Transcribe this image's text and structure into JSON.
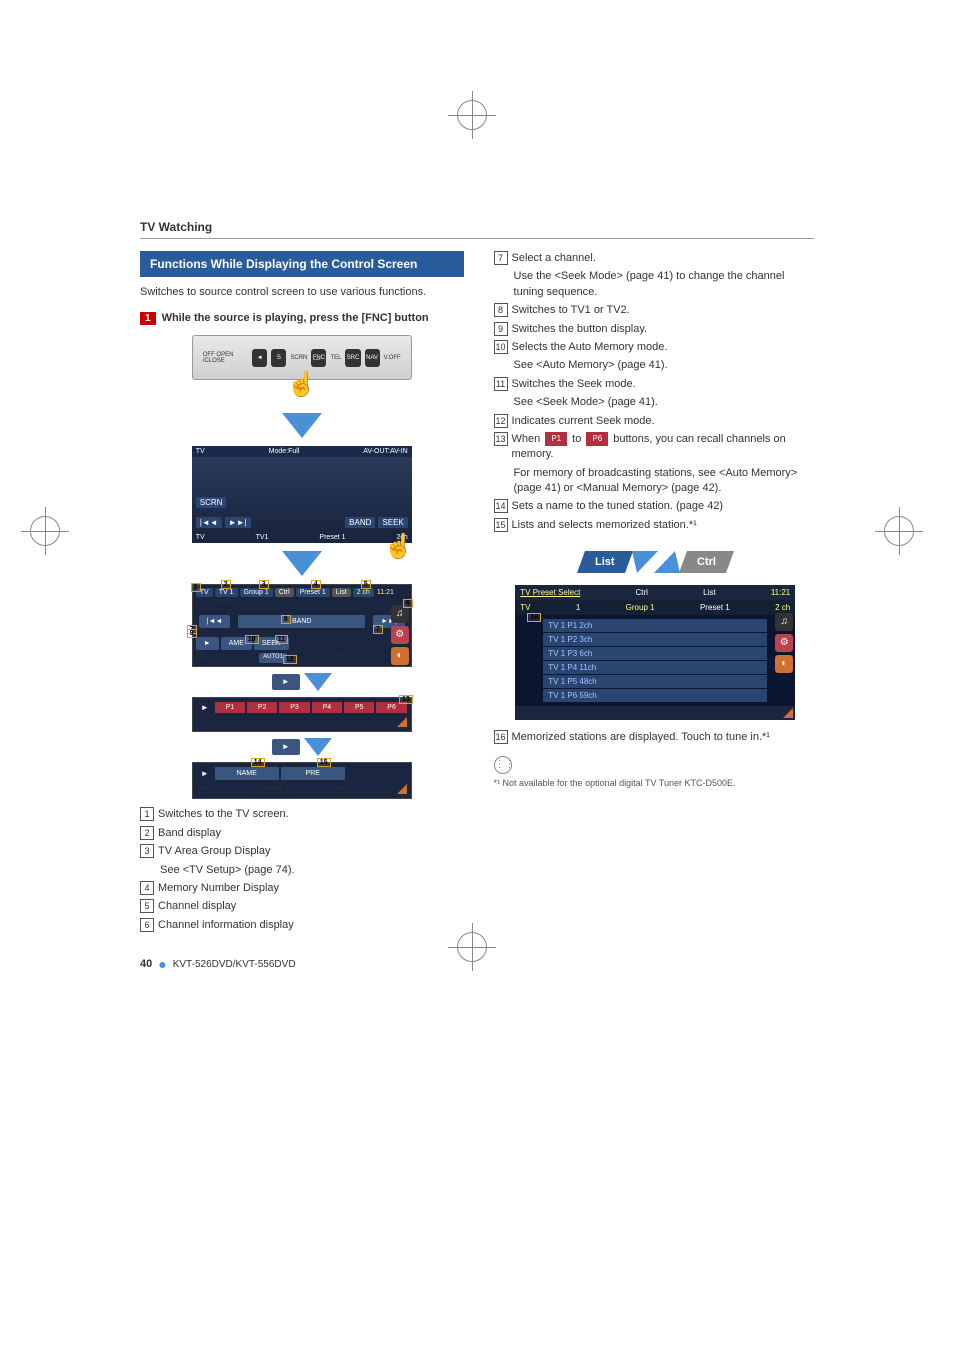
{
  "section_header": "TV Watching",
  "left": {
    "box_title": "Functions While Displaying the Control Screen",
    "intro": "Switches to source control screen to use various functions.",
    "step_num": "1",
    "step_text": "While the source is playing, press the [FNC] button",
    "device": {
      "labels": [
        "OFF OPEN /CLOSE",
        "SCRN",
        "TEL",
        "V.OFF"
      ],
      "buttons": [
        "◄",
        "S",
        "F̲N̲C",
        "SRC",
        "NAV"
      ]
    },
    "screen1_header": {
      "left": "TV",
      "mid": "Mode:Full",
      "right": "AV-OUT:AV-IN"
    },
    "screen1_scrn": "SCRN",
    "screen1_footer": {
      "tv": "TV",
      "tv1": "TV1",
      "band": "BAND",
      "seek": "SEEK",
      "preset": "Preset 1",
      "ch": "2ch"
    },
    "ctrl": {
      "top": [
        "TV",
        "TV 1",
        "Group 1",
        "Ctrl",
        "Preset 1",
        "List",
        "2 ch",
        "11:21"
      ],
      "sub": "SNPS",
      "band": "BAND",
      "prev": "|◄◄",
      "next": "►►|",
      "bottom": [
        "►",
        "AME",
        "SEEK",
        "AUTO1"
      ],
      "tel": "TEL",
      "in": "IN",
      "callouts": [
        "1",
        "2",
        "3",
        "4",
        "5",
        "6",
        "7",
        "8",
        "9",
        "10",
        "11",
        "12",
        "13"
      ]
    },
    "presets_strip": [
      "P1",
      "P2",
      "P3",
      "P4",
      "P5",
      "P6"
    ],
    "name_strip": {
      "name": "NAME",
      "pre": "PRE",
      "auto": "AUTO1",
      "tel": "TEL",
      "in": "IN"
    },
    "defs": [
      {
        "n": "1",
        "t": "Switches to the TV screen."
      },
      {
        "n": "2",
        "t": "Band display"
      },
      {
        "n": "3",
        "t": "TV Area Group Display"
      },
      {
        "n": "3b",
        "t": "See <TV Setup> (page 74)."
      },
      {
        "n": "4",
        "t": "Memory Number Display"
      },
      {
        "n": "5",
        "t": "Channel display"
      },
      {
        "n": "6",
        "t": "Channel information display"
      }
    ]
  },
  "right": {
    "defs": [
      {
        "n": "7",
        "t": "Select a channel."
      },
      {
        "n": "7b",
        "t": "Use the <Seek Mode> (page 41) to change the channel tuning sequence."
      },
      {
        "n": "8",
        "t": "Switches to TV1 or TV2."
      },
      {
        "n": "9",
        "t": "Switches the button display."
      },
      {
        "n": "10",
        "t": "Selects the Auto Memory mode."
      },
      {
        "n": "10b",
        "t": "See <Auto Memory> (page 41)."
      },
      {
        "n": "11",
        "t": "Switches the Seek mode."
      },
      {
        "n": "11b",
        "t": "See <Seek Mode> (page 41)."
      },
      {
        "n": "12",
        "t": "Indicates current Seek mode."
      },
      {
        "n": "13a",
        "t": "When ",
        "btn1": "P1",
        "mid": " to ",
        "btn2": "P6",
        "t2": " buttons, you can recall channels on memory."
      },
      {
        "n": "13b",
        "t": "For memory of broadcasting stations, see <Auto Memory> (page 41) or <Manual Memory> (page 42)."
      },
      {
        "n": "14",
        "t": "Sets a name to the tuned station. (page 42)"
      },
      {
        "n": "15",
        "t": "Lists and selects memorized station.*¹"
      }
    ],
    "tabs": {
      "list": "List",
      "ctrl": "Ctrl"
    },
    "preset_header": {
      "title": "TV Preset Select",
      "ctrl": "Ctrl",
      "list": "List",
      "time": "11:21"
    },
    "preset_sub": {
      "tv": "TV",
      "one": "1",
      "group": "Group 1",
      "preset": "Preset 1",
      "ch": "2 ch"
    },
    "preset_items": [
      "TV 1 P1 2ch",
      "TV 1 P2 3ch",
      "TV 1 P3 6ch",
      "TV 1 P4 11ch",
      "TV 1 P5 48ch",
      "TV 1 P6 59ch"
    ],
    "def16": {
      "n": "16",
      "t": "Memorized stations are displayed. Touch to tune in.*¹"
    },
    "footnote": "*¹ Not available for the optional digital TV Tuner KTC-D500E."
  },
  "footer": {
    "page": "40",
    "model": "KVT-526DVD/KVT-556DVD"
  }
}
